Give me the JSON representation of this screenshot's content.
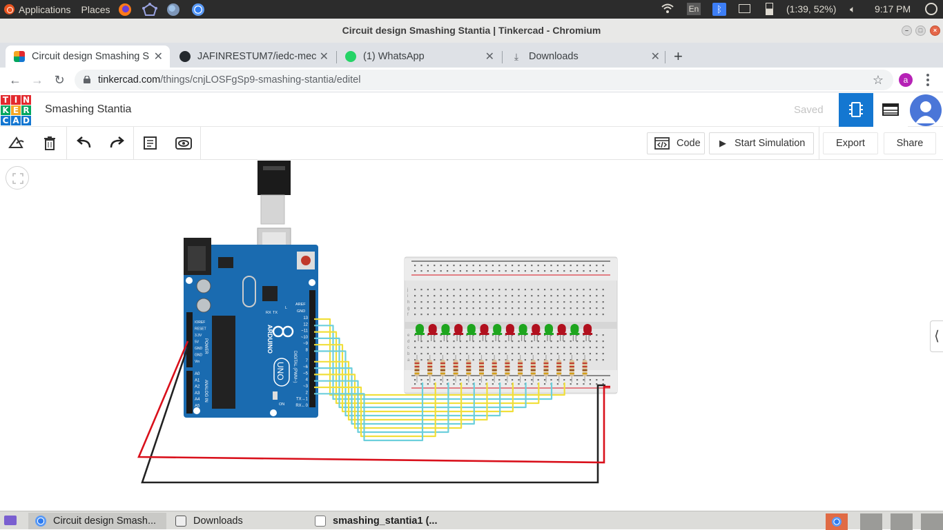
{
  "top_panel": {
    "applications": "Applications",
    "places": "Places",
    "keyboard_layout": "En",
    "battery": "(1:39, 52%)",
    "clock": "9:17 PM",
    "launchers": [
      "firefox-icon",
      "network-icon",
      "globe-icon",
      "chromium-icon"
    ]
  },
  "window": {
    "title": "Circuit design Smashing Stantia | Tinkercad - Chromium"
  },
  "tabs": [
    {
      "title": "Circuit design Smashing S",
      "icon": "tinkercad-icon",
      "active": true
    },
    {
      "title": "JAFINRESTUM7/iedc-mec",
      "icon": "github-icon",
      "active": false
    },
    {
      "title": "(1) WhatsApp",
      "icon": "whatsapp-icon",
      "active": false
    },
    {
      "title": "Downloads",
      "icon": "download-icon",
      "active": false
    }
  ],
  "new_tab_label": "+",
  "address": {
    "host": "tinkercad.com",
    "path": "/things/cnjLOSFgSp9-smashing-stantia/editel",
    "profile_initial": "a"
  },
  "tinkercad": {
    "logo_letters": [
      "T",
      "I",
      "N",
      "K",
      "E",
      "R",
      "C",
      "A",
      "D"
    ],
    "logo_colors": [
      "#e3292e",
      "#e3292e",
      "#e3292e",
      "#00a65e",
      "#f5a623",
      "#00a65e",
      "#1477d1",
      "#1477d1",
      "#1477d1"
    ],
    "design_name": "Smashing Stantia",
    "saved": "Saved"
  },
  "toolbar": {
    "code": "Code",
    "start_simulation": "Start Simulation",
    "export": "Export",
    "share": "Share"
  },
  "circuit": {
    "board_labels": {
      "aref": "AREF",
      "gnd": "GND",
      "digital": "DIGITAL (PWM~)",
      "power": "POWER",
      "analog": "ANALOG IN",
      "brand": "ARDUINO",
      "model": "UNO",
      "tx": "TX",
      "rx": "RX",
      "on": "ON",
      "l": "L",
      "power_pins": [
        "IOREF",
        "RESET",
        "3.3V",
        "5V",
        "GND",
        "GND",
        "Vin"
      ],
      "analog_pins": [
        "A0",
        "A1",
        "A2",
        "A3",
        "A4",
        "A5"
      ],
      "digital_pins": [
        "13",
        "12",
        "~11",
        "~10",
        "~9",
        "8",
        "7",
        "~6",
        "~5",
        "4",
        "~3",
        "2",
        "TX→1",
        "RX←0"
      ]
    },
    "breadboard_row_letters_top": [
      "j",
      "i",
      "h",
      "g",
      "f"
    ],
    "breadboard_row_letters_bottom": [
      "e",
      "d",
      "c",
      "b",
      "a"
    ],
    "led_colors": [
      "green",
      "red",
      "green",
      "red",
      "green",
      "red",
      "green",
      "red",
      "green",
      "red",
      "green",
      "red",
      "green",
      "red"
    ]
  },
  "colors": {
    "tinkercad_blue": "#1477d1",
    "arduino_blue": "#1a6bb0",
    "wire_yellow": "#f1df3a",
    "wire_cyan": "#6ccfdc",
    "wire_red": "#d9101b",
    "wire_black": "#222222",
    "led_green": "#1ea51e",
    "led_red": "#b1101e"
  },
  "taskbar": {
    "items": [
      {
        "title": "Circuit design Smash...",
        "icon": "chromium-icon",
        "active": true
      },
      {
        "title": "Downloads",
        "icon": "folder-icon",
        "active": false
      },
      {
        "title": "smashing_stantia1 (...",
        "icon": "text-editor-icon",
        "active": false
      }
    ]
  }
}
